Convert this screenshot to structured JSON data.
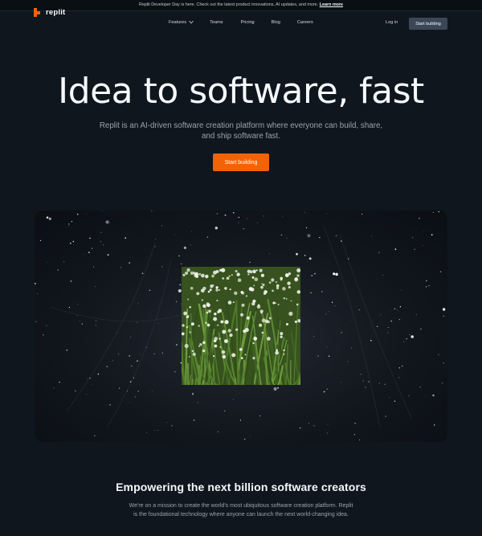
{
  "announcement": {
    "text": "Replit Developer Day is here. Check out the latest product innovations, AI updates, and more.",
    "link": "Learn more"
  },
  "brand": {
    "name": "replit",
    "color": "#f26207"
  },
  "nav": {
    "items": [
      {
        "label": "Features",
        "icon": "chevron-down-icon"
      },
      {
        "label": "Teams"
      },
      {
        "label": "Pricing"
      },
      {
        "label": "Blog"
      },
      {
        "label": "Careers"
      }
    ],
    "login": "Log in",
    "cta": "Start building"
  },
  "hero": {
    "title": "Idea to software, fast",
    "subtitle": "Replit is an AI-driven software creation platform where everyone can build, share, and ship software fast.",
    "cta": "Start building"
  },
  "mission": {
    "title": "Empowering the next billion software creators",
    "body": "We're on a mission to create the world's most ubiquitous software creation platform. Replit is the foundational technology where anyone can launch the next world-changing idea."
  }
}
